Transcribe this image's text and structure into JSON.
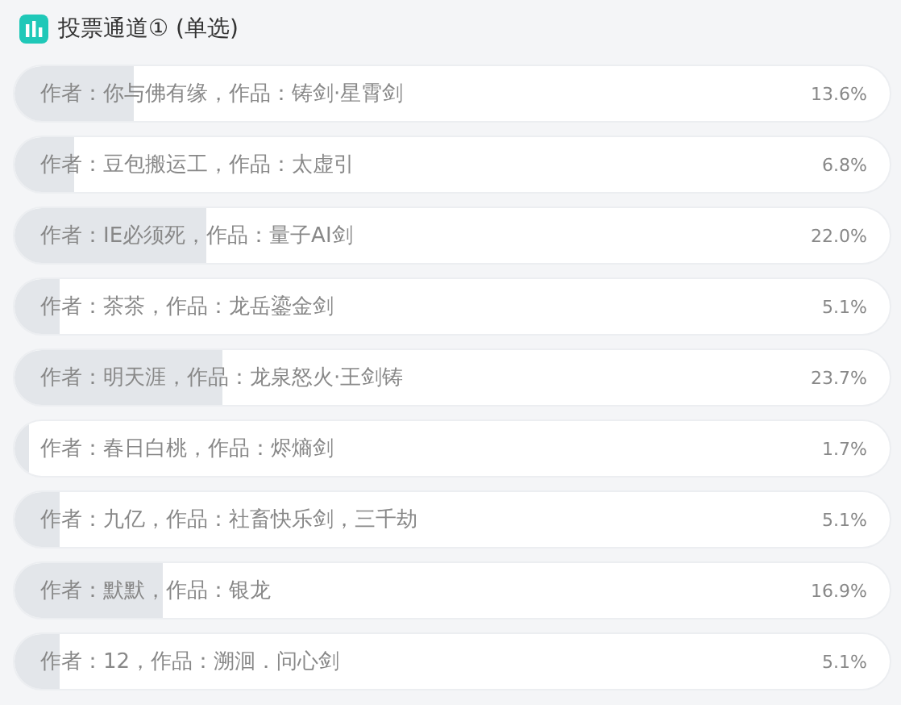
{
  "title": "投票通道① (单选)",
  "options": [
    {
      "label": "作者：你与佛有缘，作品：铸剑·星霄剑",
      "percent": "13.6%",
      "level": 0.136
    },
    {
      "label": "作者：豆包搬运工，作品：太虚引",
      "percent": "6.8%",
      "level": 0.068
    },
    {
      "label": "作者：IE必须死，作品：量子AI剑",
      "percent": "22.0%",
      "level": 0.22
    },
    {
      "label": "作者：茶茶，作品：龙岳鎏金剑",
      "percent": "5.1%",
      "level": 0.051
    },
    {
      "label": "作者：明天涯，作品：龙泉怒火·王剑铸",
      "percent": "23.7%",
      "level": 0.237
    },
    {
      "label": "作者：春日白桃，作品：烬熵剑",
      "percent": "1.7%",
      "level": 0.017
    },
    {
      "label": "作者：九亿，作品：社畜快乐剑，三千劫",
      "percent": "5.1%",
      "level": 0.051
    },
    {
      "label": "作者：默默，作品：银龙",
      "percent": "16.9%",
      "level": 0.169
    },
    {
      "label": "作者：12，作品：溯洄．问心剑",
      "percent": "5.1%",
      "level": 0.051
    }
  ]
}
